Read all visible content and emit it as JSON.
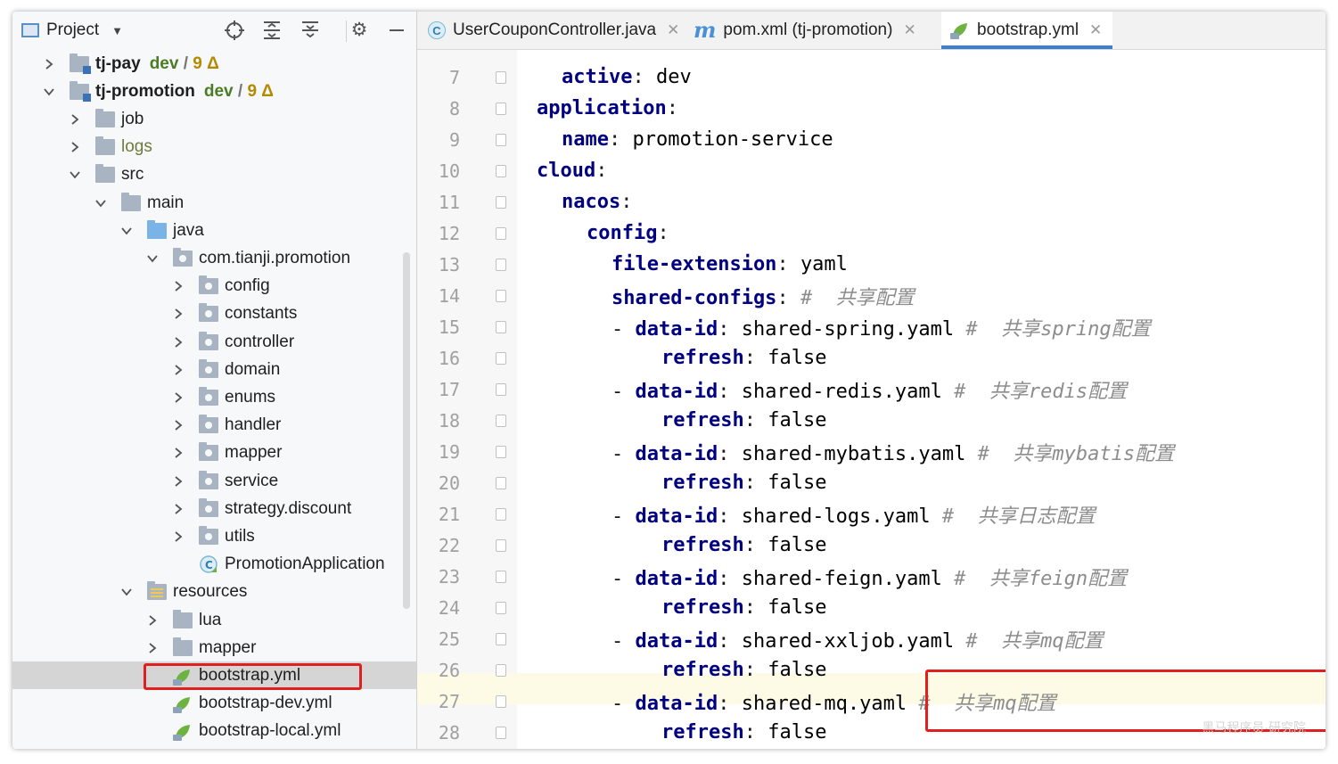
{
  "project_panel": {
    "title": "Project",
    "tree": [
      {
        "label": "tj-pay",
        "type": "module",
        "expanded": false,
        "level": 0,
        "bold": true,
        "vcs": {
          "branch": "dev",
          "sep": " / ",
          "changes": "9 Δ"
        }
      },
      {
        "label": "tj-promotion",
        "type": "module",
        "expanded": true,
        "level": 0,
        "bold": true,
        "vcs": {
          "branch": "dev",
          "sep": " / ",
          "changes": "9 Δ"
        }
      },
      {
        "label": "job",
        "type": "folder",
        "expanded": false,
        "level": 1
      },
      {
        "label": "logs",
        "type": "folder",
        "expanded": false,
        "level": 1,
        "olive": true
      },
      {
        "label": "src",
        "type": "folder",
        "expanded": true,
        "level": 1
      },
      {
        "label": "main",
        "type": "folder",
        "expanded": true,
        "level": 2
      },
      {
        "label": "java",
        "type": "folder-blue",
        "expanded": true,
        "level": 3
      },
      {
        "label": "com.tianji.promotion",
        "type": "package",
        "expanded": true,
        "level": 4
      },
      {
        "label": "config",
        "type": "package",
        "expanded": false,
        "level": 5
      },
      {
        "label": "constants",
        "type": "package",
        "expanded": false,
        "level": 5
      },
      {
        "label": "controller",
        "type": "package",
        "expanded": false,
        "level": 5
      },
      {
        "label": "domain",
        "type": "package",
        "expanded": false,
        "level": 5
      },
      {
        "label": "enums",
        "type": "package",
        "expanded": false,
        "level": 5
      },
      {
        "label": "handler",
        "type": "package",
        "expanded": false,
        "level": 5
      },
      {
        "label": "mapper",
        "type": "package",
        "expanded": false,
        "level": 5
      },
      {
        "label": "service",
        "type": "package",
        "expanded": false,
        "level": 5
      },
      {
        "label": "strategy.discount",
        "type": "package",
        "expanded": false,
        "level": 5
      },
      {
        "label": "utils",
        "type": "package",
        "expanded": false,
        "level": 5
      },
      {
        "label": "PromotionApplication",
        "type": "java",
        "expanded": null,
        "level": 5
      },
      {
        "label": "resources",
        "type": "resources",
        "expanded": true,
        "level": 3
      },
      {
        "label": "lua",
        "type": "folder",
        "expanded": false,
        "level": 4
      },
      {
        "label": "mapper",
        "type": "folder",
        "expanded": false,
        "level": 4
      },
      {
        "label": "bootstrap.yml",
        "type": "yml",
        "expanded": null,
        "level": 4,
        "selected": true
      },
      {
        "label": "bootstrap-dev.yml",
        "type": "yml",
        "expanded": null,
        "level": 4
      },
      {
        "label": "bootstrap-local.yml",
        "type": "yml",
        "expanded": null,
        "level": 4
      }
    ],
    "toolbar_icons": [
      "locate-icon",
      "expand-all-icon",
      "collapse-all-icon",
      "gear-icon",
      "minimize-icon"
    ]
  },
  "editor": {
    "tabs": [
      {
        "label": "UserCouponController.java",
        "icon": "class-icon",
        "active": false
      },
      {
        "label": "pom.xml (tj-promotion)",
        "icon": "maven-icon",
        "active": false
      },
      {
        "label": "bootstrap.yml",
        "icon": "spring-yml-icon",
        "active": true
      }
    ],
    "lines": [
      {
        "n": "7",
        "indent": 2,
        "key": "active",
        "value": "dev",
        "comment": ""
      },
      {
        "n": "8",
        "indent": 1,
        "key": "application",
        "value": "",
        "comment": ""
      },
      {
        "n": "9",
        "indent": 2,
        "key": "name",
        "value": "promotion-service",
        "comment": ""
      },
      {
        "n": "10",
        "indent": 1,
        "key": "cloud",
        "value": "",
        "comment": ""
      },
      {
        "n": "11",
        "indent": 2,
        "key": "nacos",
        "value": "",
        "comment": ""
      },
      {
        "n": "12",
        "indent": 3,
        "key": "config",
        "value": "",
        "comment": ""
      },
      {
        "n": "13",
        "indent": 4,
        "key": "file-extension",
        "value": "yaml",
        "comment": ""
      },
      {
        "n": "14",
        "indent": 4,
        "key": "shared-configs",
        "value": "",
        "comment": "#  共享配置"
      },
      {
        "n": "15",
        "indent": 5,
        "dash": true,
        "key": "data-id",
        "value": "shared-spring.yaml",
        "comment": "#  共享spring配置"
      },
      {
        "n": "16",
        "indent": 6,
        "key": "refresh",
        "value": "false",
        "comment": ""
      },
      {
        "n": "17",
        "indent": 5,
        "dash": true,
        "key": "data-id",
        "value": "shared-redis.yaml",
        "comment": "#  共享redis配置"
      },
      {
        "n": "18",
        "indent": 6,
        "key": "refresh",
        "value": "false",
        "comment": ""
      },
      {
        "n": "19",
        "indent": 5,
        "dash": true,
        "key": "data-id",
        "value": "shared-mybatis.yaml",
        "comment": "#  共享mybatis配置"
      },
      {
        "n": "20",
        "indent": 6,
        "key": "refresh",
        "value": "false",
        "comment": ""
      },
      {
        "n": "21",
        "indent": 5,
        "dash": true,
        "key": "data-id",
        "value": "shared-logs.yaml",
        "comment": "#  共享日志配置"
      },
      {
        "n": "22",
        "indent": 6,
        "key": "refresh",
        "value": "false",
        "comment": ""
      },
      {
        "n": "23",
        "indent": 5,
        "dash": true,
        "key": "data-id",
        "value": "shared-feign.yaml",
        "comment": "#  共享feign配置"
      },
      {
        "n": "24",
        "indent": 6,
        "key": "refresh",
        "value": "false",
        "comment": ""
      },
      {
        "n": "25",
        "indent": 5,
        "dash": true,
        "key": "data-id",
        "value": "shared-xxljob.yaml",
        "comment": "#  共享mq配置"
      },
      {
        "n": "26",
        "indent": 6,
        "key": "refresh",
        "value": "false",
        "comment": ""
      },
      {
        "n": "27",
        "indent": 5,
        "dash": true,
        "key": "data-id",
        "value": "shared-mq.yaml",
        "comment": "#  共享mq配置"
      },
      {
        "n": "28",
        "indent": 6,
        "key": "refresh",
        "value": "false",
        "comment": ""
      }
    ],
    "current_line": "27"
  },
  "watermark": "黑马程序员·研究院",
  "colors": {
    "highlight_box": "#e0201e",
    "key": "#000080",
    "comment": "#8c8c8c",
    "active_tab_underline": "#3a80d0"
  }
}
